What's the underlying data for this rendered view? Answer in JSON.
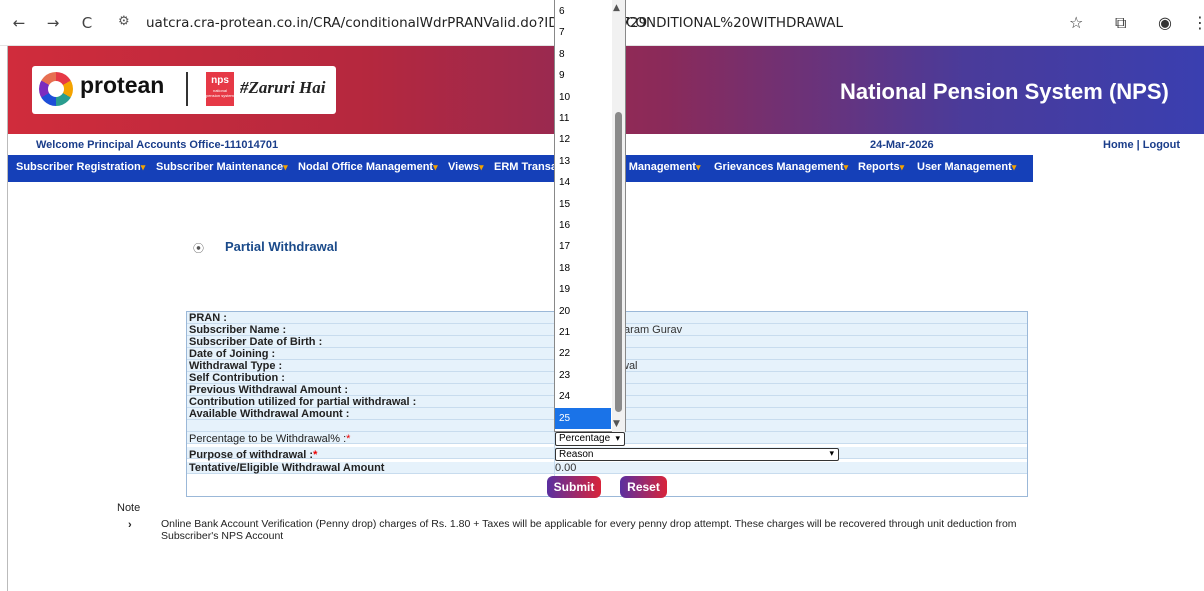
{
  "browser": {
    "url_part1": "uatcra.cra-protean.co.in/CRA/conditionalWdrPRANValid.do?ID=597412729",
    "url_part2": "CONDITIONAL%20WITHDRAWAL",
    "back_icon": "←",
    "forward_icon": "→",
    "reload_icon": "C",
    "site_info_icon": "⚙",
    "star_icon": "☆",
    "extensions_icon": "⧉",
    "profile_icon": "◉",
    "menu_icon": "⋮"
  },
  "header": {
    "brand": "protean",
    "nps_badge": "nps",
    "nps_badge_sub": "national pension system",
    "tagline": "#Zaruri Hai",
    "system_title": "National Pension System (NPS)"
  },
  "welcome": {
    "text": "Welcome Principal Accounts Office-111014701",
    "date": "24-Mar-2026",
    "home": "Home",
    "sep": " | ",
    "logout": "Logout"
  },
  "menu": [
    {
      "label": "Subscriber Registration",
      "caret": "▾"
    },
    {
      "label": "Subscriber Maintenance",
      "caret": "▾"
    },
    {
      "label": "Nodal Office Management",
      "caret": "▾"
    },
    {
      "label": "Views",
      "caret": "▾"
    },
    {
      "label": "ERM Transa",
      "caret": ""
    },
    {
      "label": "t Management",
      "caret": "▾"
    },
    {
      "label": "Grievances Management",
      "caret": "▾"
    },
    {
      "label": "Reports",
      "caret": "▾"
    },
    {
      "label": "User Management",
      "caret": "▾"
    }
  ],
  "page": {
    "bullet": "⦿",
    "title": "Partial Withdrawal"
  },
  "form": {
    "rows": [
      {
        "label": "PRAN :",
        "value": ""
      },
      {
        "label": "Subscriber Name :",
        "value": "taram Gurav"
      },
      {
        "label": "Subscriber Date of Birth :",
        "value": ""
      },
      {
        "label": "Date of Joining :",
        "value": ""
      },
      {
        "label": "Withdrawal Type :",
        "value": "wal"
      },
      {
        "label": "Self Contribution :",
        "value": ""
      },
      {
        "label": "Previous Withdrawal Amount :",
        "value": ""
      },
      {
        "label": "Contribution utilized for partial withdrawal :",
        "value": ""
      },
      {
        "label": "Available Withdrawal Amount :",
        "value": ""
      }
    ],
    "percentage_label": "Percentage to be Withdrawal% :",
    "percentage_placeholder": "Percentage",
    "purpose_label": "Purpose of withdrawal :",
    "purpose_placeholder": "Reason",
    "tentative_label": "Tentative/Eligible Withdrawal Amount",
    "tentative_value": "0.00",
    "required_mark": "*",
    "submit": "Submit",
    "reset": "Reset"
  },
  "note": {
    "label": "Note",
    "arrow": "›",
    "text": "Online Bank Account Verification (Penny drop) charges of Rs. 1.80 + Taxes will be applicable for every penny drop attempt. These charges will be recovered through unit deduction from Subscriber's NPS Account"
  },
  "dropdown": {
    "options": [
      "6",
      "7",
      "8",
      "9",
      "10",
      "11",
      "12",
      "13",
      "14",
      "15",
      "16",
      "17",
      "18",
      "19",
      "20",
      "21",
      "22",
      "23",
      "24",
      "25"
    ],
    "selected": "25",
    "arrow": "▾"
  }
}
